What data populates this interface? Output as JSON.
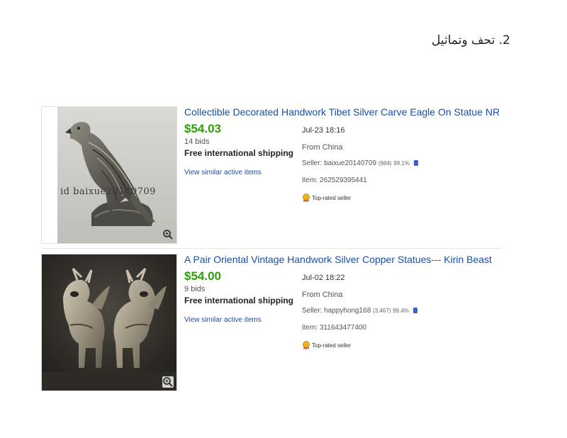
{
  "heading": "2. تحف وتماثيل",
  "listings": [
    {
      "title": "Collectible Decorated Handwork Tibet Silver Carve Eagle On Statue NR",
      "price": "$54.03",
      "bids": "14 bids",
      "shipping": "Free international shipping",
      "similar_link": "View similar active items",
      "date": "Jul-23 18:16",
      "origin": "From China",
      "seller_label": "Seller: baixue20140709",
      "seller_feedback": "(984)",
      "seller_percent": "99.1%",
      "item_number": "Item: 262529395441",
      "top_rated": "Top-rated seller",
      "watermark": "id baixue20140709",
      "image": "silver-eagle-statue-photo"
    },
    {
      "title": "A Pair Oriental Vintage Handwork Silver Copper Statues--- Kirin Beast",
      "price": "$54.00",
      "bids": "9 bids",
      "shipping": "Free international shipping",
      "similar_link": "View similar active items",
      "date": "Jul-02 18:22",
      "origin": "From China",
      "seller_label": "Seller: happyhong168",
      "seller_feedback": "(3,467)",
      "seller_percent": "99.4%",
      "item_number": "Item: 311643477400",
      "top_rated": "Top-rated seller",
      "image": "silver-kirin-pair-photo"
    }
  ],
  "icons": {
    "zoom": "magnifier-icon",
    "top_rated": "ribbon-medal-icon",
    "seller_doc": "document-icon"
  },
  "colors": {
    "title_link": "#1a4fa6",
    "price": "#2f9c0a",
    "top_rated_badge": "#e9b320"
  }
}
